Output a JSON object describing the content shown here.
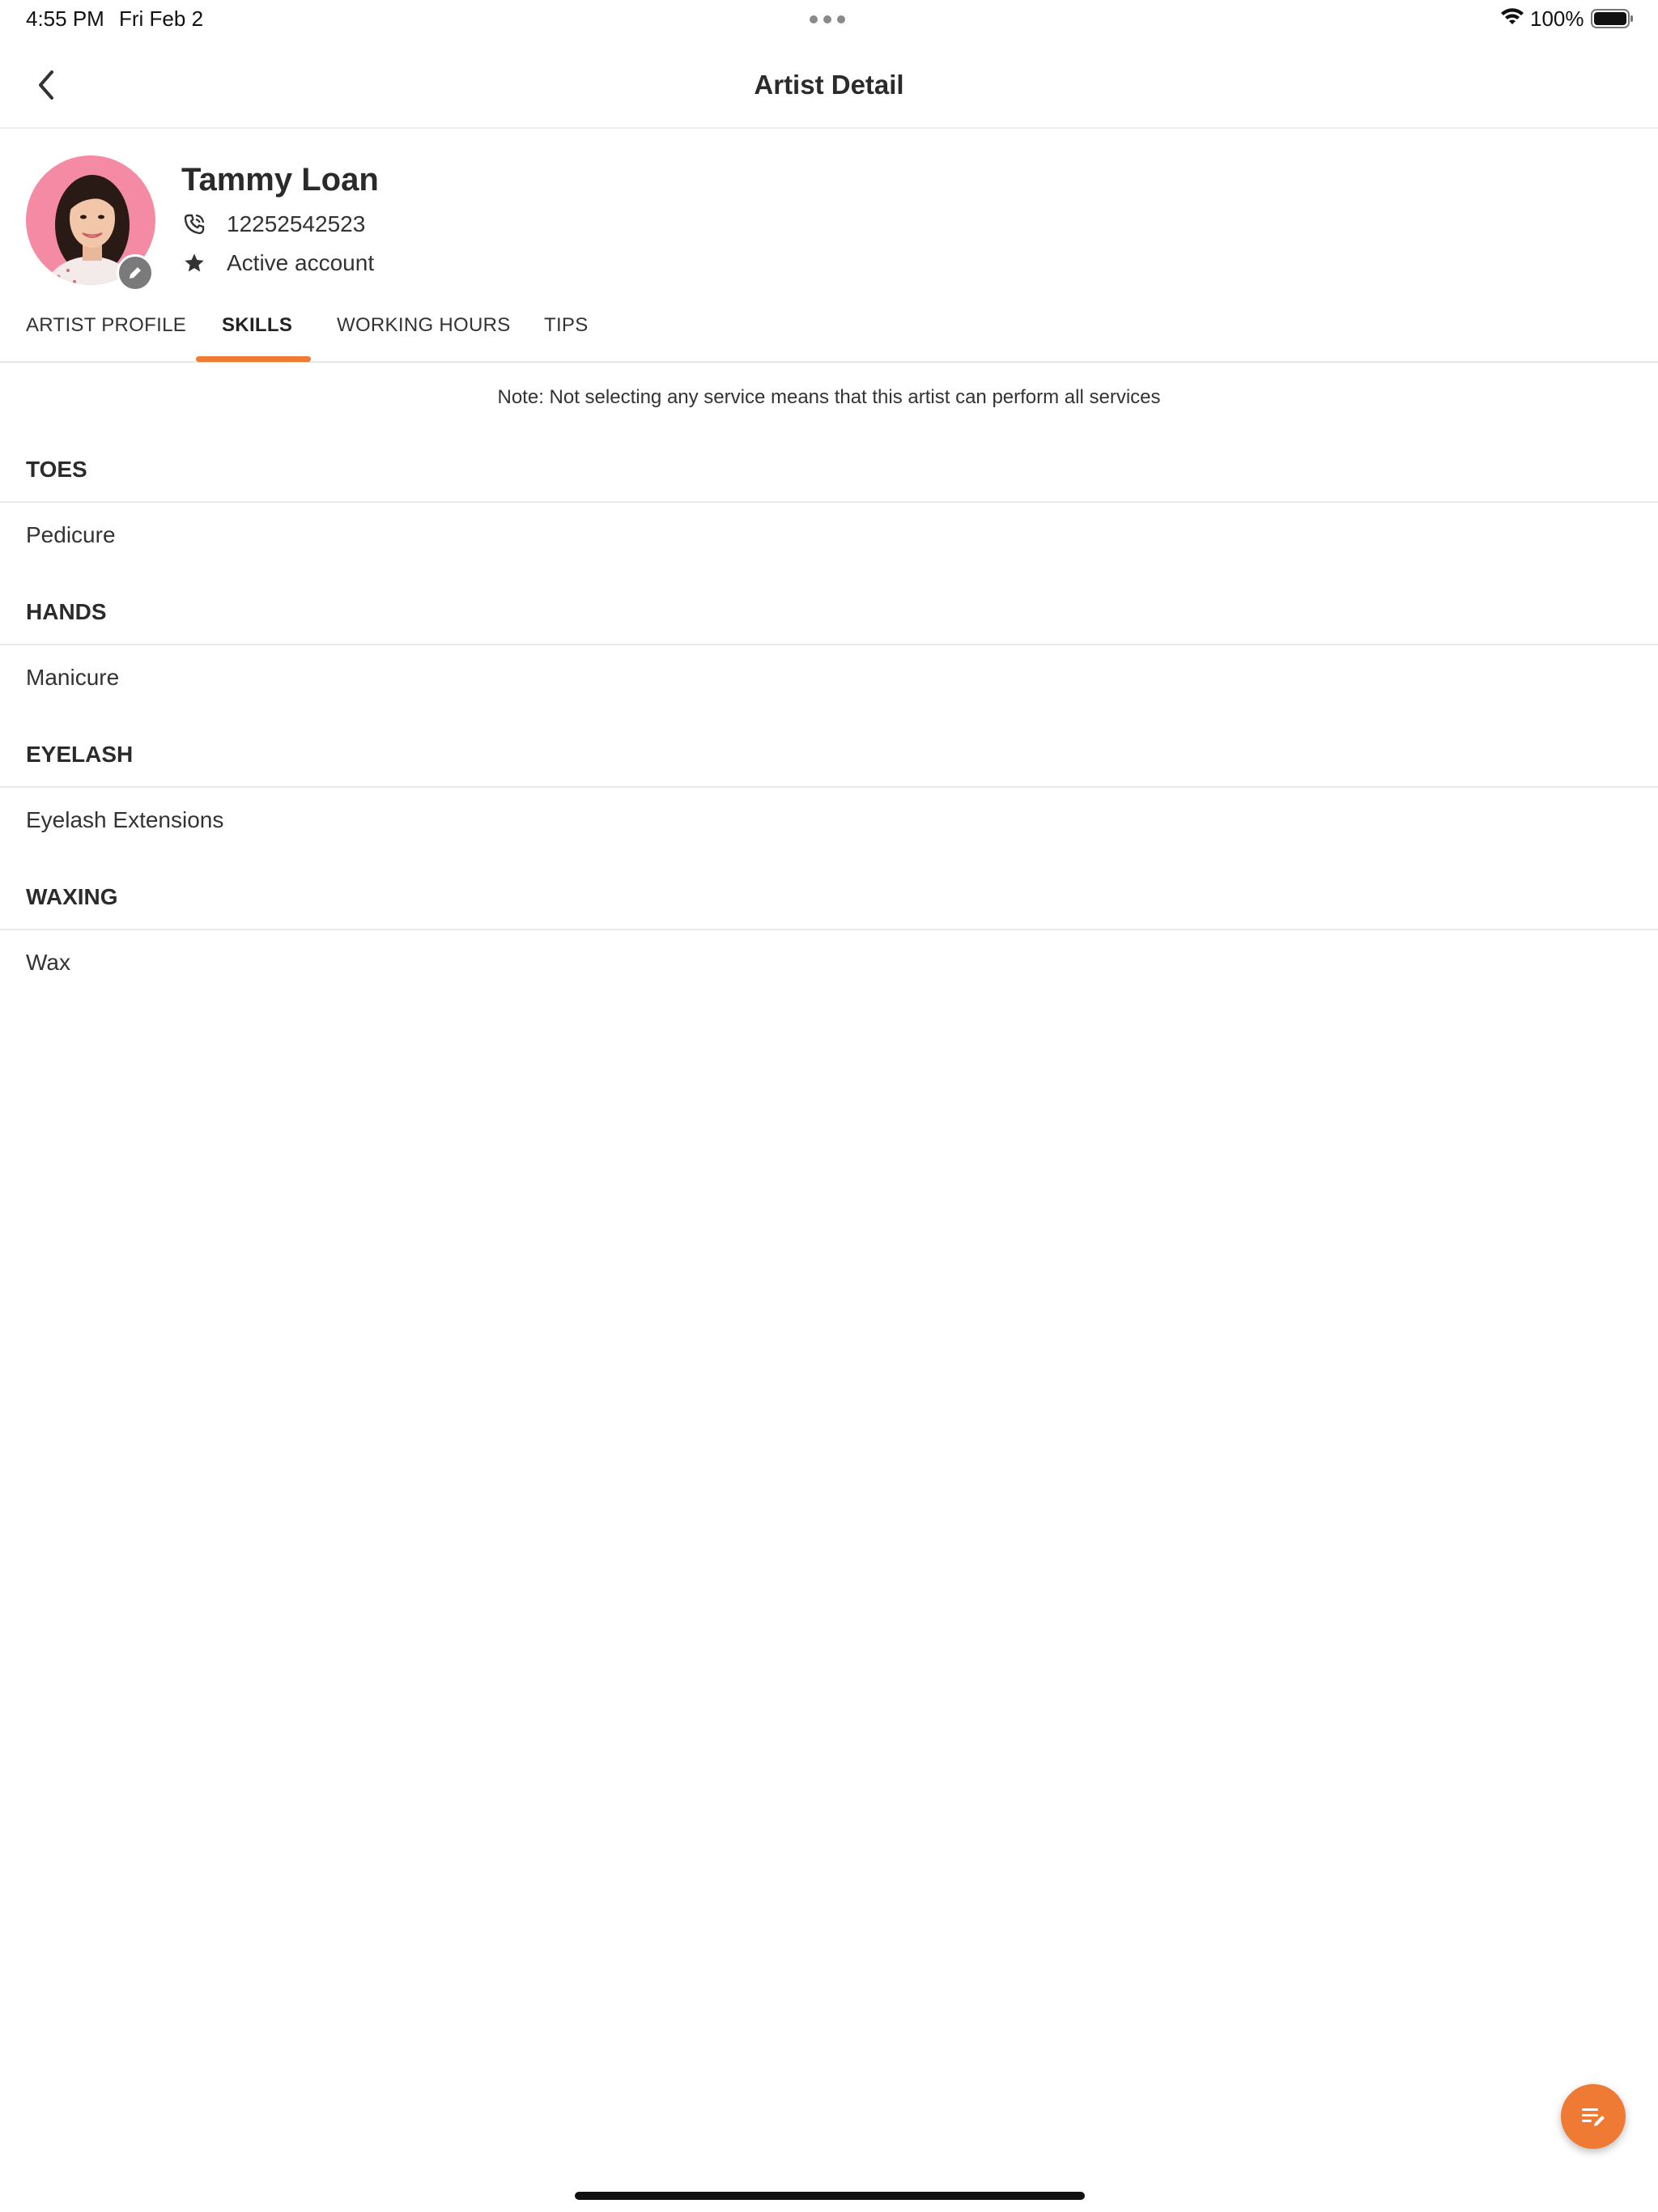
{
  "status_bar": {
    "time": "4:55 PM",
    "date": "Fri Feb 2",
    "battery": "100%",
    "icons": [
      "wifi-icon",
      "battery-icon"
    ]
  },
  "header": {
    "title": "Artist Detail",
    "back_icon": "chevron-left-icon"
  },
  "profile": {
    "name": "Tammy Loan",
    "phone": "12252542523",
    "account_status": "Active account",
    "icons": [
      "phone-icon",
      "star-icon",
      "pencil-icon"
    ]
  },
  "tabs": [
    {
      "label": "ARTIST PROFILE",
      "active": false
    },
    {
      "label": "SKILLS",
      "active": true
    },
    {
      "label": "WORKING HOURS",
      "active": false
    },
    {
      "label": "TIPS",
      "active": false
    }
  ],
  "note": "Note: Not selecting any service means that this artist can perform all services",
  "skills": [
    {
      "group": "TOES",
      "services": [
        "Pedicure"
      ]
    },
    {
      "group": "HANDS",
      "services": [
        "Manicure"
      ]
    },
    {
      "group": "EYELASH",
      "services": [
        "Eyelash Extensions"
      ]
    },
    {
      "group": "WAXING",
      "services": [
        "Wax"
      ]
    }
  ],
  "fab": {
    "icon": "edit-list-icon"
  },
  "colors": {
    "accent": "#ee7a33",
    "divider": "#ebebeb",
    "text": "#333333"
  }
}
